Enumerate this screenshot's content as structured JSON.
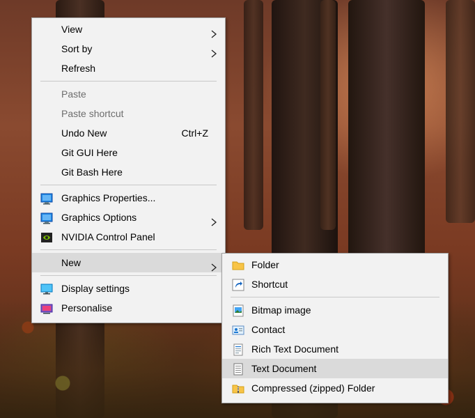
{
  "context_menu": {
    "groups": [
      [
        {
          "label": "View",
          "submenu": true
        },
        {
          "label": "Sort by",
          "submenu": true
        },
        {
          "label": "Refresh"
        }
      ],
      [
        {
          "label": "Paste",
          "disabled": true
        },
        {
          "label": "Paste shortcut",
          "disabled": true
        },
        {
          "label": "Undo New",
          "shortcut": "Ctrl+Z"
        },
        {
          "label": "Git GUI Here"
        },
        {
          "label": "Git Bash Here"
        }
      ],
      [
        {
          "label": "Graphics Properties...",
          "icon": "intel-graphics-icon"
        },
        {
          "label": "Graphics Options",
          "icon": "intel-graphics-icon",
          "submenu": true
        },
        {
          "label": "NVIDIA Control Panel",
          "icon": "nvidia-icon"
        }
      ],
      [
        {
          "label": "New",
          "submenu": true,
          "highlighted": true
        }
      ],
      [
        {
          "label": "Display settings",
          "icon": "monitor-icon"
        },
        {
          "label": "Personalise",
          "icon": "personalise-icon"
        }
      ]
    ]
  },
  "new_submenu": {
    "groups": [
      [
        {
          "label": "Folder",
          "icon": "folder-icon"
        },
        {
          "label": "Shortcut",
          "icon": "shortcut-icon"
        }
      ],
      [
        {
          "label": "Bitmap image",
          "icon": "bitmap-icon"
        },
        {
          "label": "Contact",
          "icon": "contact-icon"
        },
        {
          "label": "Rich Text Document",
          "icon": "rich-text-icon"
        },
        {
          "label": "Text Document",
          "icon": "text-document-icon",
          "highlighted": true
        },
        {
          "label": "Compressed (zipped) Folder",
          "icon": "zip-folder-icon"
        }
      ]
    ]
  },
  "colors": {
    "menu_background": "#f2f2f2",
    "menu_border": "#a0a0a0",
    "highlight": "#dadada",
    "disabled_text": "#6d6d6d"
  }
}
